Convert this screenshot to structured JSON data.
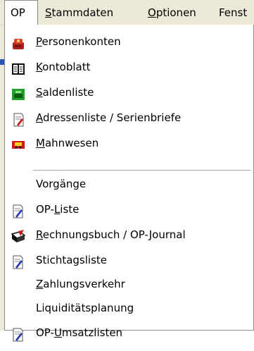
{
  "menubar": {
    "items": [
      {
        "label": "OP",
        "access": ""
      },
      {
        "pre": "",
        "access": "S",
        "rest": "tammdaten"
      },
      {
        "pre": "",
        "access": "O",
        "rest": "ptionen"
      },
      {
        "label": "Fenst"
      }
    ]
  },
  "menu": {
    "items": [
      {
        "pre": "",
        "access": "P",
        "rest": "ersonenkonten",
        "icon": "person-accounts-icon"
      },
      {
        "pre": "",
        "access": "K",
        "rest": "ontoblatt",
        "icon": "account-sheet-icon"
      },
      {
        "pre": "",
        "access": "S",
        "rest": "aldenliste",
        "icon": "balance-list-icon"
      },
      {
        "pre": "",
        "access": "A",
        "rest": "dressenliste / Serienbriefe",
        "icon": "address-list-icon"
      },
      {
        "pre": "",
        "access": "M",
        "rest": "ahnwesen",
        "icon": "dunning-icon"
      },
      {
        "pre": "",
        "access": "",
        "rest": "Vorgänge",
        "icon": ""
      },
      {
        "pre": "OP-",
        "access": "L",
        "rest": "iste",
        "icon": "op-list-icon"
      },
      {
        "pre": "",
        "access": "R",
        "rest": "echnungsbuch / OP-Journal",
        "icon": "invoice-book-icon"
      },
      {
        "pre": "",
        "access": "",
        "rest": "Stichtagsliste",
        "icon": "reference-date-list-icon"
      },
      {
        "pre": "",
        "access": "Z",
        "rest": "ahlungsverkehr",
        "icon": ""
      },
      {
        "pre": "",
        "access": "",
        "rest": "Liquiditätsplanung",
        "icon": ""
      },
      {
        "pre": "OP-",
        "access": "U",
        "rest": "msatzlisten",
        "icon": "op-sales-list-icon"
      }
    ]
  }
}
